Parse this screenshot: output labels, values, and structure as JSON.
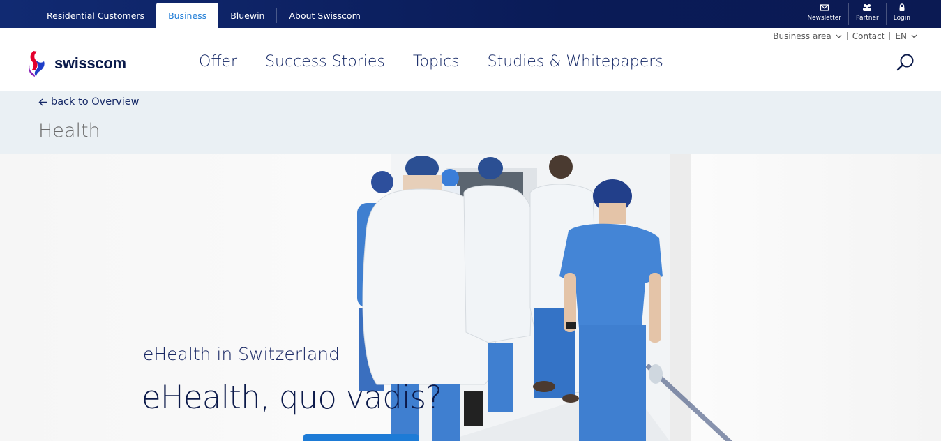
{
  "topbar": {
    "tabs": [
      {
        "label": "Residential Customers",
        "active": false
      },
      {
        "label": "Business",
        "active": true
      },
      {
        "label": "Bluewin",
        "active": false
      },
      {
        "label": "About Swisscom",
        "active": false
      }
    ],
    "icons": [
      {
        "label": "Newsletter",
        "icon": "mail-icon"
      },
      {
        "label": "Partner",
        "icon": "partner-icon"
      },
      {
        "label": "Login",
        "icon": "lock-icon"
      }
    ]
  },
  "header": {
    "logo_text": "swisscom",
    "nav": [
      "Offer",
      "Success Stories",
      "Topics",
      "Studies & Whitepapers"
    ],
    "util": {
      "business_area": "Business area",
      "contact": "Contact",
      "language": "EN"
    }
  },
  "breadcrumb": {
    "back_label": "back to Overview",
    "category": "Health"
  },
  "hero": {
    "kicker": "eHealth in Switzerland",
    "headline": "eHealth, quo vadis?"
  },
  "colors": {
    "topbar": "#0b1a53",
    "active_tab_text": "#1d7bd6",
    "nav_text": "#152866",
    "band": "#eaf0f4",
    "scrub_blue": "#3f7fd0",
    "cta": "#1d7bd6"
  }
}
